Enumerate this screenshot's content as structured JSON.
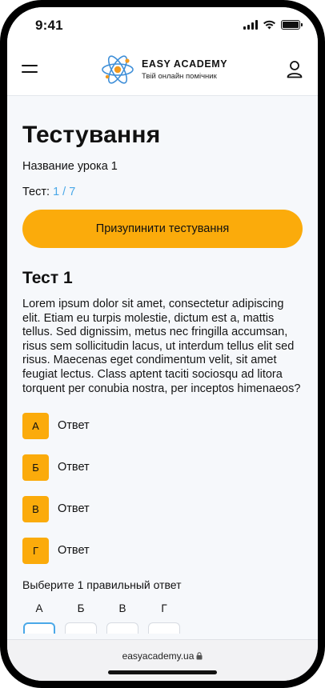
{
  "status_bar": {
    "time": "9:41"
  },
  "header": {
    "logo_name": "EASY ACADEMY",
    "logo_tagline": "Твій онлайн помічник"
  },
  "page": {
    "title": "Тестування",
    "lesson_name": "Название урока 1",
    "test_label": "Тест:",
    "test_progress": "1 / 7",
    "pause_button": "Призупинити тестування"
  },
  "question": {
    "heading": "Тест 1",
    "text": "Lorem ipsum dolor sit amet, consectetur adipiscing elit. Etiam eu turpis molestie, dictum est a, mattis tellus. Sed dignissim, metus nec fringilla accumsan, risus sem sollicitudin lacus, ut interdum tellus elit sed risus. Maecenas eget condimentum velit, sit amet feugiat lectus. Class aptent taciti sociosqu ad litora torquent per conubia nostra, per inceptos himenaeos?",
    "answers": [
      {
        "letter": "А",
        "text": "Ответ"
      },
      {
        "letter": "Б",
        "text": "Ответ"
      },
      {
        "letter": "В",
        "text": "Ответ"
      },
      {
        "letter": "Г",
        "text": "Ответ"
      }
    ]
  },
  "selection": {
    "hint": "Выберите 1 правильный ответ",
    "options": [
      "А",
      "Б",
      "В",
      "Г"
    ]
  },
  "browser": {
    "url": "easyacademy.ua"
  },
  "colors": {
    "accent": "#fbab0b",
    "link": "#4aa8e8",
    "logo_orange": "#f39a1e",
    "logo_blue": "#3f8fd8"
  }
}
